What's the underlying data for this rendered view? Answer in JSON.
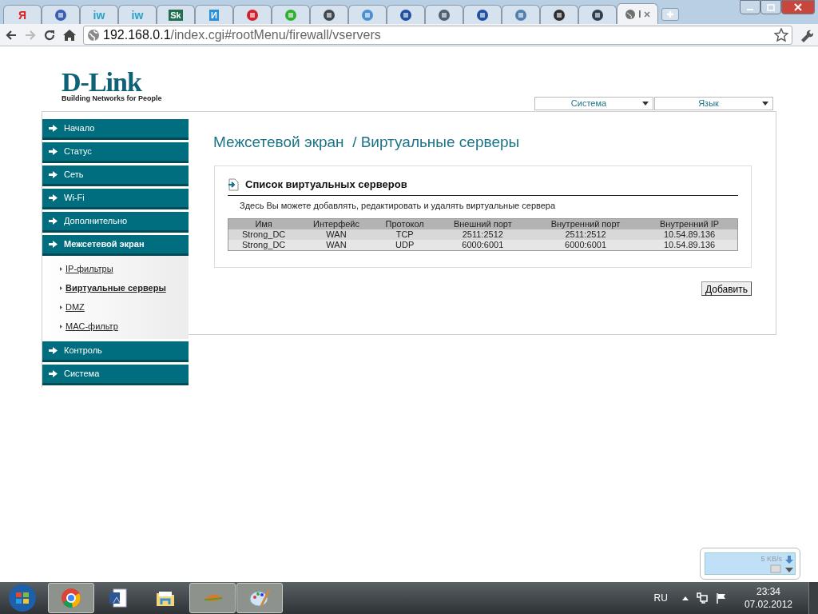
{
  "browser": {
    "tabs": [
      {
        "kind": "letter",
        "text": "Я",
        "color": "#e02020",
        "selected": false
      },
      {
        "kind": "shape",
        "color": "#3a5fb0",
        "selected": false
      },
      {
        "kind": "letter",
        "text": "iw",
        "color": "#2aa0c8",
        "selected": false
      },
      {
        "kind": "letter",
        "text": "iw",
        "color": "#2aa0c8",
        "selected": false
      },
      {
        "kind": "badge",
        "text": "Sk",
        "color": "#1f6f50",
        "selected": false
      },
      {
        "kind": "badge",
        "text": "И",
        "color": "#2a90d8",
        "selected": false
      },
      {
        "kind": "shape",
        "color": "#d02030",
        "selected": false
      },
      {
        "kind": "shape",
        "color": "#30b030",
        "selected": false
      },
      {
        "kind": "shape",
        "color": "#404850",
        "selected": false
      },
      {
        "kind": "shape",
        "color": "#4a90d0",
        "selected": false
      },
      {
        "kind": "shape",
        "color": "#2050a0",
        "selected": false
      },
      {
        "kind": "shape",
        "color": "#506070",
        "selected": false
      },
      {
        "kind": "shape",
        "color": "#2050a0",
        "selected": false
      },
      {
        "kind": "shape",
        "color": "#5080b0",
        "selected": false
      },
      {
        "kind": "shape",
        "color": "#303030",
        "selected": false
      },
      {
        "kind": "shape",
        "color": "#304050",
        "selected": false
      },
      {
        "kind": "globe",
        "text": "I",
        "color": "#707070",
        "selected": true
      }
    ],
    "url_host": "192.168.0.1",
    "url_path": "/index.cgi#rootMenu/firewall/vservers"
  },
  "logo": {
    "brand": "D-Link",
    "tagline": "Building Networks for People"
  },
  "top_menus": [
    "Система",
    "Язык"
  ],
  "sidebar": [
    {
      "label": "Начало",
      "expanded": false
    },
    {
      "label": "Статус",
      "expanded": false
    },
    {
      "label": "Сеть",
      "expanded": false
    },
    {
      "label": "Wi-Fi",
      "expanded": false
    },
    {
      "label": "Дополнительно",
      "expanded": false
    },
    {
      "label": "Межсетевой экран",
      "expanded": true,
      "children": [
        {
          "label": "IP-фильтры",
          "selected": false
        },
        {
          "label": "Виртуальные серверы",
          "selected": true
        },
        {
          "label": "DMZ",
          "selected": false
        },
        {
          "label": "MAC-фильтр",
          "selected": false
        }
      ]
    },
    {
      "label": "Контроль",
      "expanded": false
    },
    {
      "label": "Система",
      "expanded": false
    }
  ],
  "page_title": "Межсетевой экран  / Виртуальные серверы",
  "section": {
    "title": "Список виртуальных серверов",
    "description": "Здесь Вы можете добавлять, редактировать и удалять виртуальные сервера"
  },
  "table": {
    "columns": [
      "Имя",
      "Интерфейс",
      "Протокол",
      "Внешний порт",
      "Внутренний порт",
      "Внутренний IP"
    ],
    "rows": [
      [
        "Strong_DC",
        "WAN",
        "TCP",
        "2511:2512",
        "2511:2512",
        "10.54.89.136"
      ],
      [
        "Strong_DC",
        "WAN",
        "UDP",
        "6000:6001",
        "6000:6001",
        "10.54.89.136"
      ]
    ]
  },
  "add_button": "Добавить",
  "net_widget": {
    "speed": "5 KB/s"
  },
  "taskbar": {
    "apps": [
      {
        "kind": "chrome",
        "running": true
      },
      {
        "kind": "word",
        "running": false
      },
      {
        "kind": "folder",
        "running": false
      },
      {
        "kind": "leaf",
        "running": true
      },
      {
        "kind": "paint",
        "running": true
      }
    ],
    "language": "RU",
    "time": "23:34",
    "date": "07.02.2012"
  }
}
